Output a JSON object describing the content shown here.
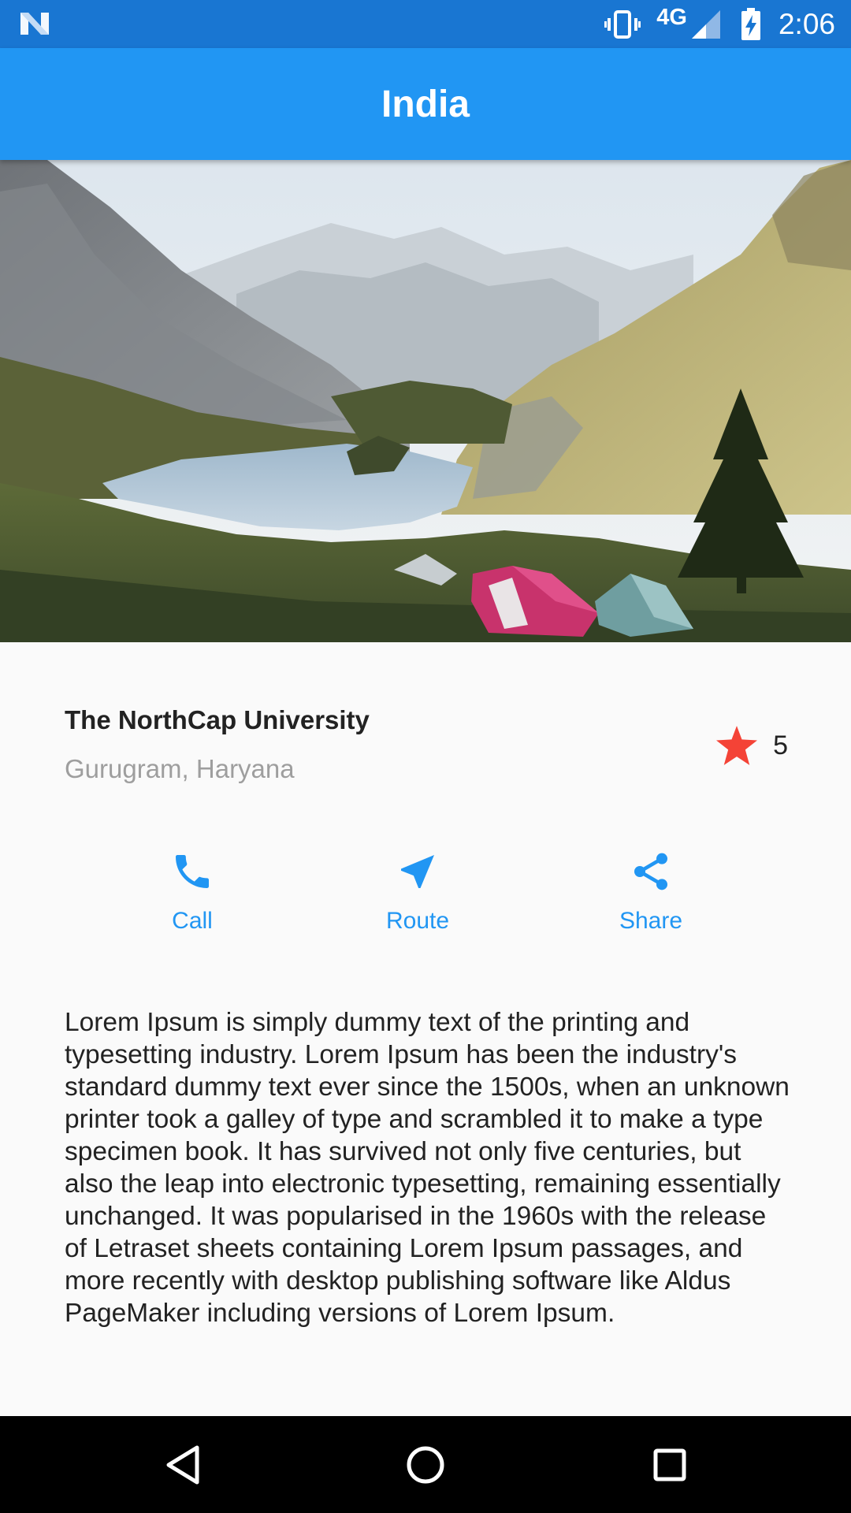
{
  "status_bar": {
    "network": "4G",
    "time": "2:06"
  },
  "app_bar": {
    "title": "India"
  },
  "place": {
    "name": "The NorthCap University",
    "location": "Gurugram, Haryana",
    "rating": "5"
  },
  "actions": [
    {
      "label": "Call",
      "icon": "phone-icon"
    },
    {
      "label": "Route",
      "icon": "navigation-icon"
    },
    {
      "label": "Share",
      "icon": "share-icon"
    }
  ],
  "description": "Lorem Ipsum is simply dummy text of the printing and typesetting industry. Lorem Ipsum has been the industry's standard dummy text ever since the 1500s, when an unknown printer took a galley of type and scrambled it to make a type specimen book. It has survived not only five centuries, but also the leap into electronic typesetting, remaining essentially unchanged. It was popularised in the 1960s with the release of Letraset sheets containing Lorem Ipsum passages, and more recently with desktop publishing software like Aldus PageMaker including versions of Lorem Ipsum.",
  "colors": {
    "primary": "#2196f3",
    "primary_dark": "#1976d2",
    "star": "#f44336"
  }
}
